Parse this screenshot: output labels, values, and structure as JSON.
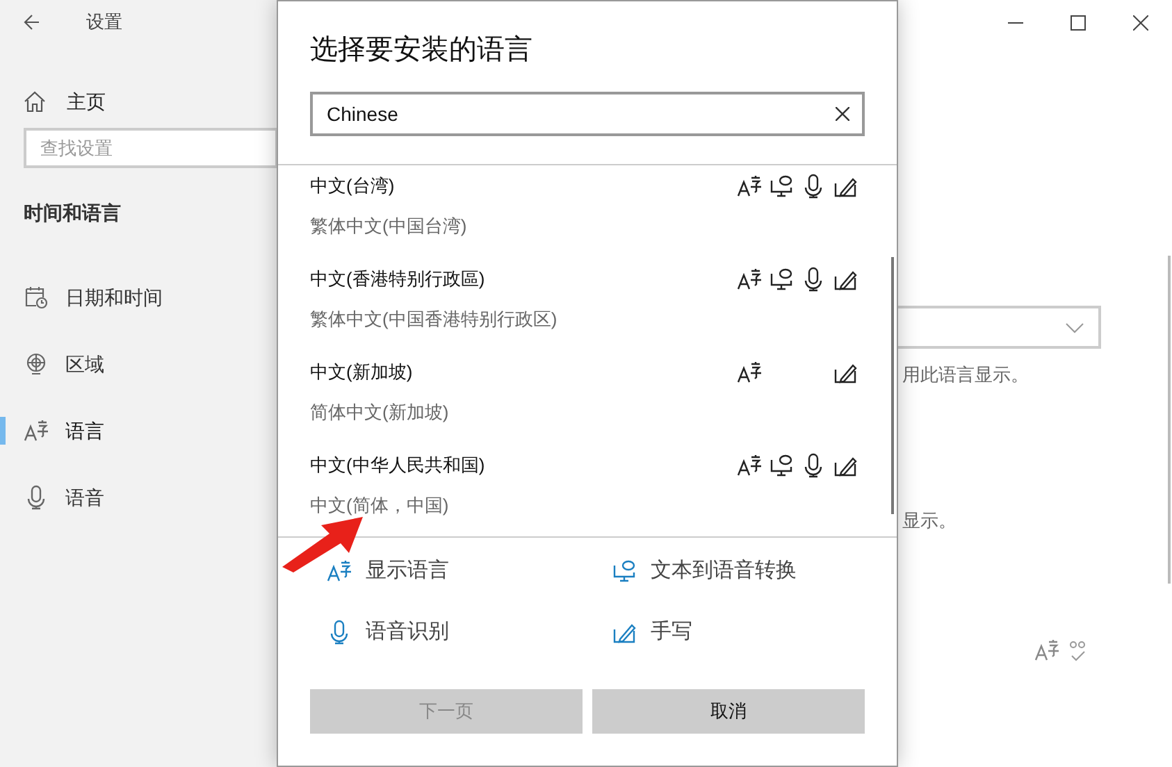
{
  "window": {
    "title": "设置"
  },
  "sidebar": {
    "home": "主页",
    "search": {
      "placeholder": "查找设置"
    },
    "section": "时间和语言",
    "items": [
      {
        "label": "日期和时间",
        "kind": "calendar",
        "selected": false
      },
      {
        "label": "区域",
        "kind": "globe",
        "selected": false
      },
      {
        "label": "语言",
        "kind": "language",
        "selected": true
      },
      {
        "label": "语音",
        "kind": "microphone",
        "selected": false
      }
    ]
  },
  "main": {
    "note_1": "用此语言显示。",
    "note_2": "显示。"
  },
  "dialog": {
    "title": "选择要安装的语言",
    "search": {
      "value": "Chinese"
    },
    "languages": [
      {
        "name": "中文(台湾)",
        "subtitle": "繁体中文(中国台湾)",
        "display": true,
        "tts": true,
        "speech": true,
        "handwriting": true
      },
      {
        "name": "中文(香港特别行政區)",
        "subtitle": "繁体中文(中国香港特别行政区)",
        "display": true,
        "tts": true,
        "speech": true,
        "handwriting": true
      },
      {
        "name": "中文(新加坡)",
        "subtitle": "简体中文(新加坡)",
        "display": true,
        "tts": false,
        "speech": false,
        "handwriting": true
      },
      {
        "name": "中文(中华人民共和国)",
        "subtitle": "中文(简体，中国)",
        "display": true,
        "tts": true,
        "speech": true,
        "handwriting": true
      }
    ],
    "legend": [
      {
        "kind": "display",
        "label": "显示语言"
      },
      {
        "kind": "tts",
        "label": "文本到语音转换"
      },
      {
        "kind": "speech",
        "label": "语音识别"
      },
      {
        "kind": "handwriting",
        "label": "手写"
      }
    ],
    "buttons": [
      {
        "label": "下一页",
        "disabled": true
      },
      {
        "label": "取消",
        "disabled": false
      }
    ]
  }
}
